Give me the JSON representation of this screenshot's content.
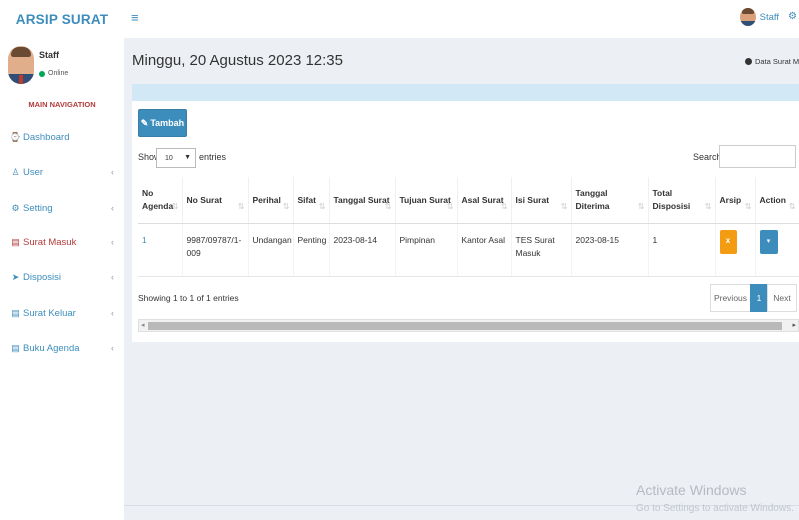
{
  "app": {
    "logo": "ARSIP SURAT",
    "menu_icon": "≡"
  },
  "topbar": {
    "user_name": "Staff",
    "settings_icon": "gear-icon"
  },
  "sidebar": {
    "user": {
      "name": "Staff",
      "status": "Online"
    },
    "nav_header": "MAIN NAVIGATION",
    "items": [
      {
        "label": "Dashboard",
        "icon": "dashboard-icon"
      },
      {
        "label": "User",
        "icon": "user-icon"
      },
      {
        "label": "Setting",
        "icon": "gear-icon"
      },
      {
        "label": "Surat Masuk",
        "icon": "file-icon"
      },
      {
        "label": "Disposisi",
        "icon": "send-icon"
      },
      {
        "label": "Surat Keluar",
        "icon": "file-icon"
      },
      {
        "label": "Buku Agenda",
        "icon": "book-icon"
      }
    ]
  },
  "header": {
    "datetime": "Minggu, 20 Agustus 2023 12:35",
    "breadcrumb": "Data Surat Masuk"
  },
  "toolbar": {
    "add_label": "Tambah"
  },
  "table_controls": {
    "show_label": "Show",
    "length_value": "10",
    "entries_label": "entries",
    "search_label": "Search:"
  },
  "table": {
    "columns": [
      "No Agenda",
      "No Surat",
      "Perihal",
      "Sifat",
      "Tanggal Surat",
      "Tujuan Surat",
      "Asal Surat",
      "Isi Surat",
      "Tanggal Diterima",
      "Total Disposisi",
      "Arsip",
      "Action"
    ],
    "rows": [
      [
        "1",
        "9987/09787/1-009",
        "Undangan",
        "Penting",
        "2023-08-14",
        "Pimpinan",
        "Kantor Asal",
        "TES Surat Masuk",
        "2023-08-15",
        "1"
      ]
    ],
    "arsip_button": "x",
    "action_button": "▾"
  },
  "pagination": {
    "info": "Showing 1 to 1 of 1 entries",
    "previous": "Previous",
    "current": "1",
    "next": "Next"
  },
  "watermark": {
    "title": "Activate Windows",
    "subtitle": "Go to Settings to activate Windows."
  },
  "colors": {
    "accent": "#3c8dbc",
    "menu_red": "#b33a3a",
    "online": "#00a65a",
    "warning": "#f39c12"
  }
}
